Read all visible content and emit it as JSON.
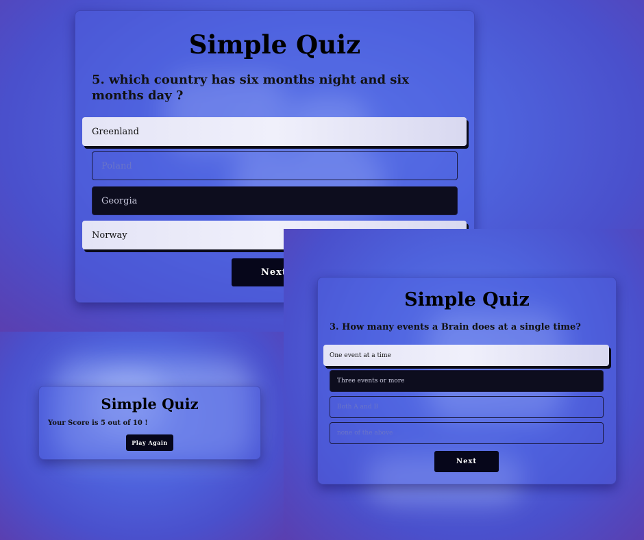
{
  "panel1": {
    "title": "Simple Quiz",
    "question": "5. which country has six months night and six months day ?",
    "options": [
      {
        "label": "Greenland",
        "state": "hover"
      },
      {
        "label": "Poland",
        "state": "default"
      },
      {
        "label": "Georgia",
        "state": "selected"
      },
      {
        "label": "Norway",
        "state": "hover"
      }
    ],
    "next_label": "Next"
  },
  "panel2": {
    "title": "Simple Quiz",
    "score_text": "Your Score is 5 out of 10 !",
    "play_again_label": "Play Again"
  },
  "panel3": {
    "title": "Simple Quiz",
    "question": "3. How many events a Brain does at a single time?",
    "options": [
      {
        "label": "One event at a time",
        "state": "hover"
      },
      {
        "label": "Three events or more",
        "state": "selected"
      },
      {
        "label": "Both A and B",
        "state": "default"
      },
      {
        "label": "none of the above",
        "state": "default"
      }
    ],
    "next_label": "Next"
  },
  "colors": {
    "background": "#4e5ad6",
    "button": "#06061a",
    "option_light": "#e8e8f8",
    "option_dark": "#0d0d1e"
  }
}
